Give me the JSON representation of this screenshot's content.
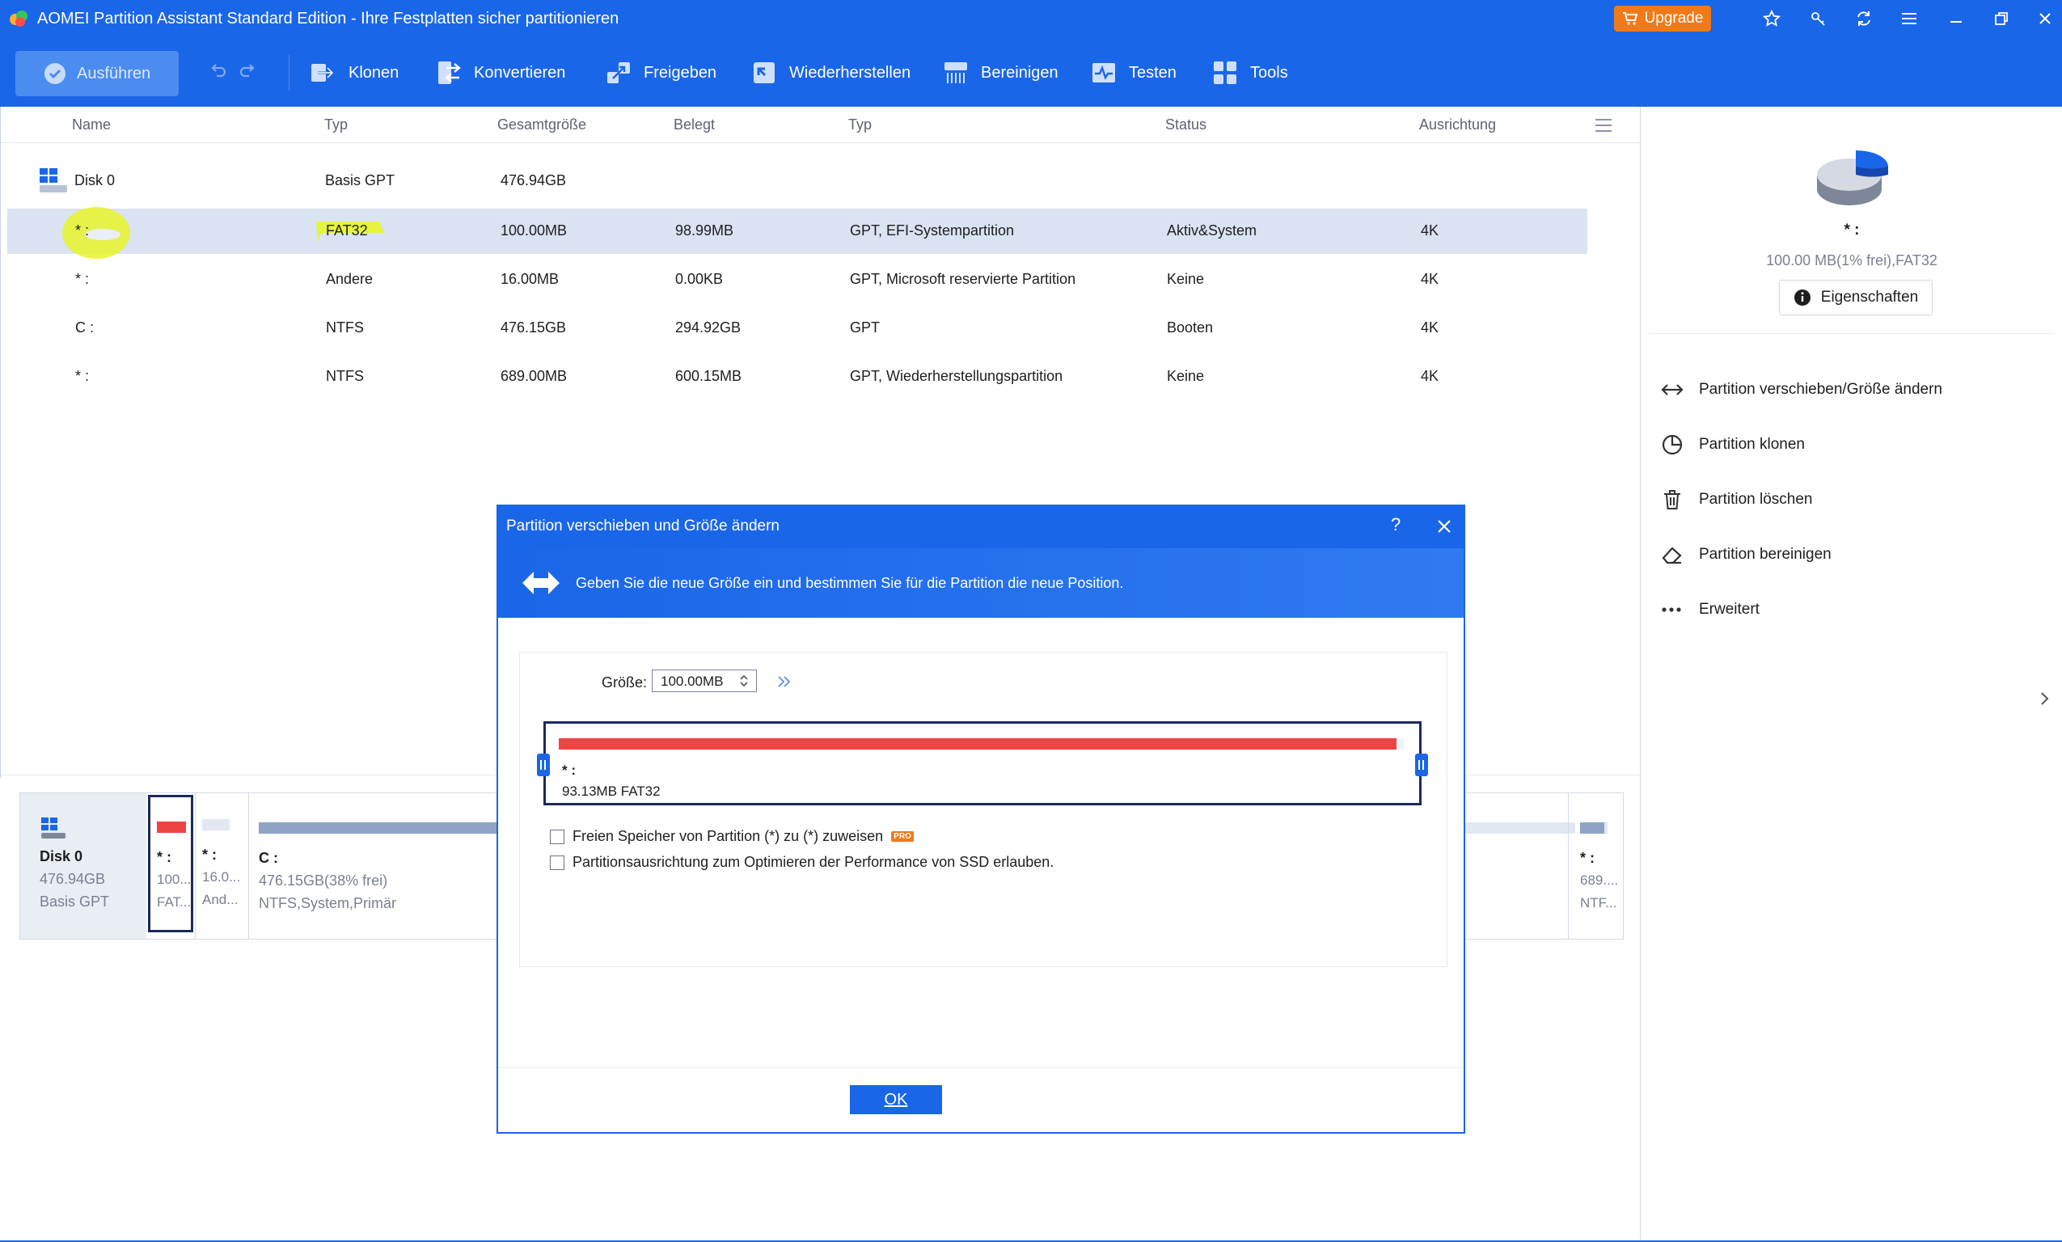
{
  "window": {
    "title": "AOMEI Partition Assistant Standard Edition - Ihre Festplatten sicher partitionieren",
    "upgrade_label": "Upgrade"
  },
  "toolbar": {
    "apply_label": "Ausführen",
    "items": [
      {
        "label": "Klonen",
        "icon": "clone-icon"
      },
      {
        "label": "Konvertieren",
        "icon": "convert-icon"
      },
      {
        "label": "Freigeben",
        "icon": "free-up-icon"
      },
      {
        "label": "Wiederherstellen",
        "icon": "recover-icon"
      },
      {
        "label": "Bereinigen",
        "icon": "wipe-icon"
      },
      {
        "label": "Testen",
        "icon": "test-icon"
      },
      {
        "label": "Tools",
        "icon": "tools-icon"
      }
    ]
  },
  "table": {
    "headers": [
      "Name",
      "Typ",
      "Gesamtgröße",
      "Belegt",
      "Typ",
      "Status",
      "Ausrichtung"
    ],
    "disk": {
      "name": "Disk 0",
      "type": "Basis GPT",
      "total": "476.94GB"
    },
    "rows": [
      {
        "name": "* :",
        "fs": "FAT32",
        "total": "100.00MB",
        "used": "98.99MB",
        "ptype": "GPT, EFI-Systempartition",
        "status": "Aktiv&System",
        "align": "4K"
      },
      {
        "name": "* :",
        "fs": "Andere",
        "total": "16.00MB",
        "used": "0.00KB",
        "ptype": "GPT, Microsoft reservierte Partition",
        "status": "Keine",
        "align": "4K"
      },
      {
        "name": "C :",
        "fs": "NTFS",
        "total": "476.15GB",
        "used": "294.92GB",
        "ptype": "GPT",
        "status": "Booten",
        "align": "4K"
      },
      {
        "name": "* :",
        "fs": "NTFS",
        "total": "689.00MB",
        "used": "600.15MB",
        "ptype": "GPT, Wiederherstellungspartition",
        "status": "Keine",
        "align": "4K"
      }
    ]
  },
  "right_pane": {
    "partition_name": "* :",
    "partition_info": "100.00 MB(1% frei),FAT32",
    "properties_label": "Eigenschaften",
    "operations": [
      {
        "label": "Partition verschieben/Größe ändern",
        "icon": "resize-arrows-icon"
      },
      {
        "label": "Partition klonen",
        "icon": "clone-partition-icon"
      },
      {
        "label": "Partition löschen",
        "icon": "trash-icon"
      },
      {
        "label": "Partition bereinigen",
        "icon": "eraser-icon"
      },
      {
        "label": "Erweitert",
        "icon": "more-dots-icon"
      }
    ]
  },
  "disk_map": {
    "disk": {
      "name": "Disk 0",
      "size": "476.94GB",
      "type": "Basis GPT"
    },
    "partitions": [
      {
        "name": "* :",
        "size": "100...",
        "fs": "FAT...",
        "used_fraction": 0.99,
        "color": "#ef4444"
      },
      {
        "name": "* :",
        "size": "16.0...",
        "fs": "And...",
        "used_fraction": 0.0,
        "color": "#e1e8f2"
      },
      {
        "name": "C :",
        "size": "476.15GB(38% frei)",
        "fs": "NTFS,System,Primär",
        "used_fraction": 0.62,
        "color": "#8fa4c4"
      },
      {
        "name": "* :",
        "size": "689....",
        "fs": "NTF...",
        "used_fraction": 0.87,
        "color": "#8fa4c4"
      }
    ]
  },
  "dialog": {
    "title": "Partition verschieben und Größe ändern",
    "help": "?",
    "banner_text": "Geben Sie die neue Größe ein und bestimmen Sie für die Partition die neue Position.",
    "size_label": "Größe:",
    "size_value": "100.00MB",
    "bar_partition_name": "* :",
    "bar_partition_info": "93.13MB FAT32",
    "checkbox1": "Freien Speicher von Partition (*) zu (*) zuweisen",
    "pro_badge": "PRO",
    "checkbox2": "Partitionsausrichtung zum Optimieren der Performance von SSD erlauben.",
    "ok_label": "OK"
  },
  "colors": {
    "brand_blue": "#1a66e8",
    "upgrade_orange": "#f07a1a",
    "selected_row": "#d9e3f2",
    "highlight_yellow": "#e8f52a",
    "used_red": "#ef4444",
    "dialog_border": "#1b2a5e"
  }
}
